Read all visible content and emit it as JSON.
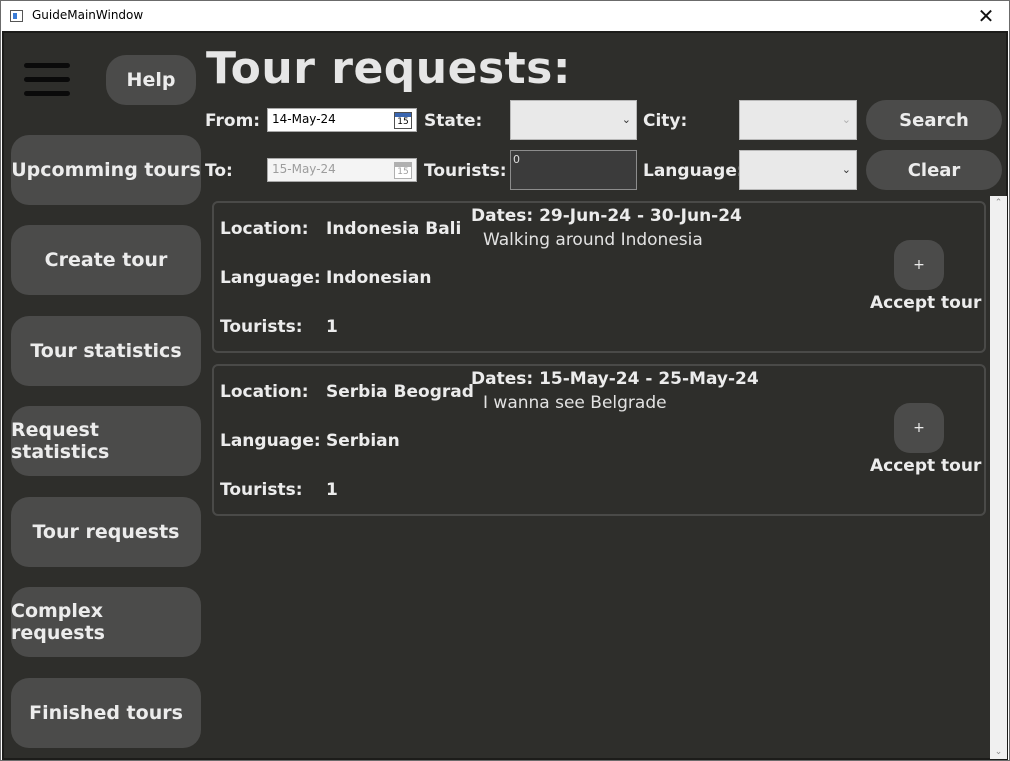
{
  "window": {
    "title": "GuideMainWindow",
    "close_glyph": "✕"
  },
  "sidebar": {
    "help_label": "Help",
    "items": [
      {
        "label": "Upcomming tours"
      },
      {
        "label": "Create tour"
      },
      {
        "label": "Tour statistics"
      },
      {
        "label": "Request statistics"
      },
      {
        "label": "Tour requests"
      },
      {
        "label": "Complex requests"
      },
      {
        "label": "Finished tours"
      }
    ]
  },
  "page": {
    "title": "Tour requests:"
  },
  "filters": {
    "from_label": "From:",
    "from_value": "14-May-24",
    "to_label": "To:",
    "to_value": "15-May-24",
    "calendar_glyph": "15",
    "state_label": "State:",
    "state_value": "",
    "city_label": "City:",
    "city_value": "",
    "tourists_label": "Tourists:",
    "tourists_value": "0",
    "language_label": "Language:",
    "language_value": "",
    "chevron_glyph": "⌄",
    "search_label": "Search",
    "clear_label": "Clear"
  },
  "requests": [
    {
      "location_label": "Location:",
      "location": "Indonesia Bali",
      "language_label": "Language:",
      "language": "Indonesian",
      "tourists_label": "Tourists:",
      "tourists": "1",
      "dates": "Dates: 29-Jun-24 - 30-Jun-24",
      "description": "Walking around Indonesia",
      "plus_glyph": "+",
      "accept_label": "Accept tour"
    },
    {
      "location_label": "Location:",
      "location": "Serbia Beograd",
      "language_label": "Language:",
      "language": "Serbian",
      "tourists_label": "Tourists:",
      "tourists": "1",
      "dates": "Dates: 15-May-24 - 25-May-24",
      "description": "I wanna see Belgrade",
      "plus_glyph": "+",
      "accept_label": "Accept tour"
    }
  ],
  "scrollbar": {
    "up_glyph": "⌃",
    "down_glyph": "⌄"
  }
}
